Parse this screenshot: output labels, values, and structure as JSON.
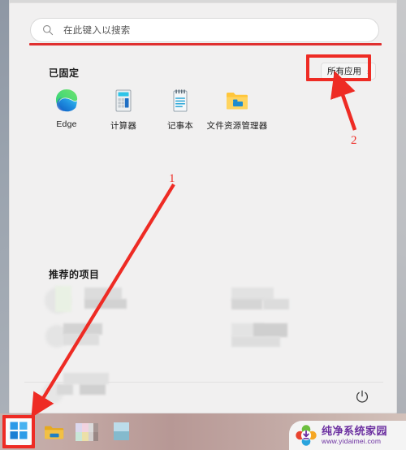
{
  "window": {
    "name": "windows-11-start-menu"
  },
  "search": {
    "placeholder": "在此键入以搜索",
    "value": "",
    "icon": "search-icon"
  },
  "pinned": {
    "header": "已固定",
    "all_apps_label": "所有应用",
    "all_apps_chevron": "›",
    "apps": [
      {
        "label": "Edge",
        "icon": "edge-icon"
      },
      {
        "label": "计算器",
        "icon": "calculator-icon"
      },
      {
        "label": "记事本",
        "icon": "notepad-icon"
      },
      {
        "label": "文件资源管理器",
        "icon": "file-explorer-icon"
      }
    ]
  },
  "recommended": {
    "header": "推荐的项目",
    "items_blurred": true
  },
  "account": {
    "name_blurred": true,
    "power_icon": "power-icon"
  },
  "taskbar": {
    "items": [
      {
        "name": "start-button",
        "icon": "windows-logo-icon"
      },
      {
        "name": "file-explorer",
        "icon": "folder-icon"
      },
      {
        "name": "microsoft-store",
        "icon": "store-icon"
      },
      {
        "name": "edge-taskbar",
        "icon": "blue-app-icon"
      }
    ]
  },
  "annotations": [
    {
      "id": "1",
      "label": "1",
      "target": "start-button"
    },
    {
      "id": "2",
      "label": "2",
      "target": "all-apps-button"
    }
  ],
  "watermark": {
    "title": "纯净系统家园",
    "url": "www.yidaimei.com",
    "logo": "flower-download-logo"
  },
  "colors": {
    "annotation_red": "#ee2b24",
    "panel_bg": "#f1f0f0",
    "watermark_purple": "#6b2fa0",
    "accent_blue": "#0078d4"
  }
}
